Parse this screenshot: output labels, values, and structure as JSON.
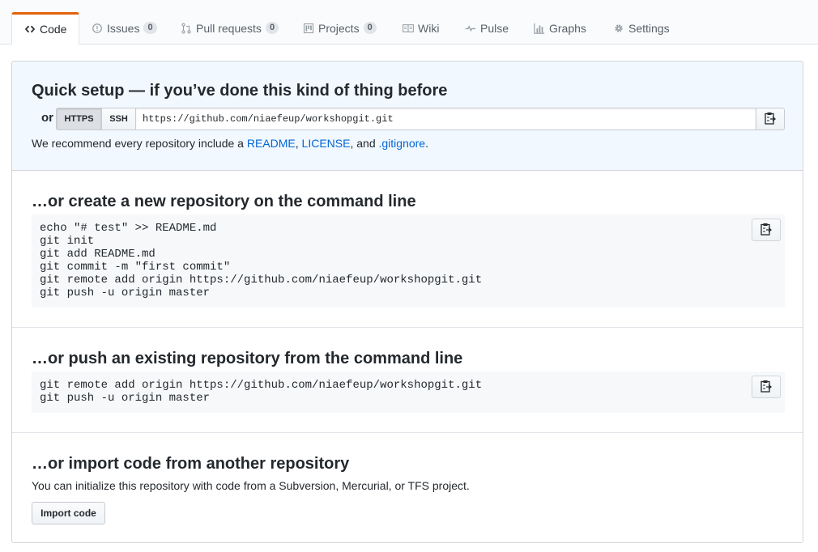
{
  "tabs": [
    {
      "label": "Code",
      "icon": "code-icon",
      "counter": null
    },
    {
      "label": "Issues",
      "icon": "issue-opened-icon",
      "counter": "0"
    },
    {
      "label": "Pull requests",
      "icon": "git-pull-request-icon",
      "counter": "0"
    },
    {
      "label": "Projects",
      "icon": "project-icon",
      "counter": "0"
    },
    {
      "label": "Wiki",
      "icon": "book-icon",
      "counter": null
    },
    {
      "label": "Pulse",
      "icon": "pulse-icon",
      "counter": null
    },
    {
      "label": "Graphs",
      "icon": "graph-icon",
      "counter": null
    },
    {
      "label": "Settings",
      "icon": "gear-icon",
      "counter": null
    }
  ],
  "quick_setup": {
    "title": "Quick setup — if you’ve done this kind of thing before",
    "or_label": "or",
    "https_label": "HTTPS",
    "ssh_label": "SSH",
    "clone_url": "https://github.com/niaefeup/workshopgit.git",
    "recommend_prefix": "We recommend every repository include a ",
    "readme": "README",
    "sep1": ", ",
    "license": "LICENSE",
    "sep2": ", and ",
    "gitignore": ".gitignore",
    "suffix": "."
  },
  "new_repo": {
    "title": "…or create a new repository on the command line",
    "lines": [
      "echo \"# test\" >> README.md",
      "git init",
      "git add README.md",
      "git commit -m \"first commit\"",
      "git remote add origin https://github.com/niaefeup/workshopgit.git",
      "git push -u origin master"
    ]
  },
  "push_existing": {
    "title": "…or push an existing repository from the command line",
    "lines": [
      "git remote add origin https://github.com/niaefeup/workshopgit.git",
      "git push -u origin master"
    ]
  },
  "import": {
    "title": "…or import code from another repository",
    "description": "You can initialize this repository with code from a Subversion, Mercurial, or TFS project.",
    "button_label": "Import code"
  },
  "colors": {
    "accent_tab": "#e36209",
    "link": "#0366d6",
    "quick_bg": "#f1f8ff"
  }
}
